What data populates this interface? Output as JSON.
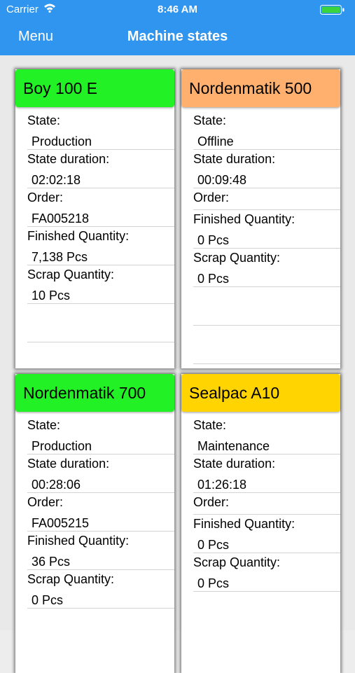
{
  "status_bar": {
    "carrier": "Carrier",
    "time": "8:46 AM",
    "icons": [
      "wifi-icon",
      "battery-icon"
    ]
  },
  "navbar": {
    "menu_label": "Menu",
    "title": "Machine states"
  },
  "colors": {
    "navbar": "#2f95ef",
    "production": "#22f225",
    "offline": "#ffb06e",
    "maintenance": "#ffd400"
  },
  "machines": [
    {
      "name": "Boy 100 E",
      "status_color": "#22f225",
      "state_label": "State:",
      "state": "Production",
      "duration_label": "State duration:",
      "duration": "02:02:18",
      "order_label": "Order:",
      "order": "FA005218",
      "finished_label": "Finished Quantity:",
      "finished": "7,138 Pcs",
      "scrap_label": "Scrap Quantity:",
      "scrap": "10 Pcs"
    },
    {
      "name": "Nordenmatik 500",
      "status_color": "#ffb06e",
      "state_label": "State:",
      "state": "Offline",
      "duration_label": "State duration:",
      "duration": "00:09:48",
      "order_label": "Order:",
      "order": "",
      "finished_label": "Finished Quantity:",
      "finished": "0 Pcs",
      "scrap_label": "Scrap Quantity:",
      "scrap": "0 Pcs"
    },
    {
      "name": "Nordenmatik 700",
      "status_color": "#22f225",
      "state_label": "State:",
      "state": "Production",
      "duration_label": "State duration:",
      "duration": "00:28:06",
      "order_label": "Order:",
      "order": "FA005215",
      "finished_label": "Finished Quantity:",
      "finished": "36 Pcs",
      "scrap_label": "Scrap Quantity:",
      "scrap": "0 Pcs"
    },
    {
      "name": "Sealpac A10",
      "status_color": "#ffd400",
      "state_label": "State:",
      "state": "Maintenance",
      "duration_label": "State duration:",
      "duration": "01:26:18",
      "order_label": "Order:",
      "order": "",
      "finished_label": "Finished Quantity:",
      "finished": "0 Pcs",
      "scrap_label": "Scrap Quantity:",
      "scrap": "0 Pcs"
    }
  ]
}
